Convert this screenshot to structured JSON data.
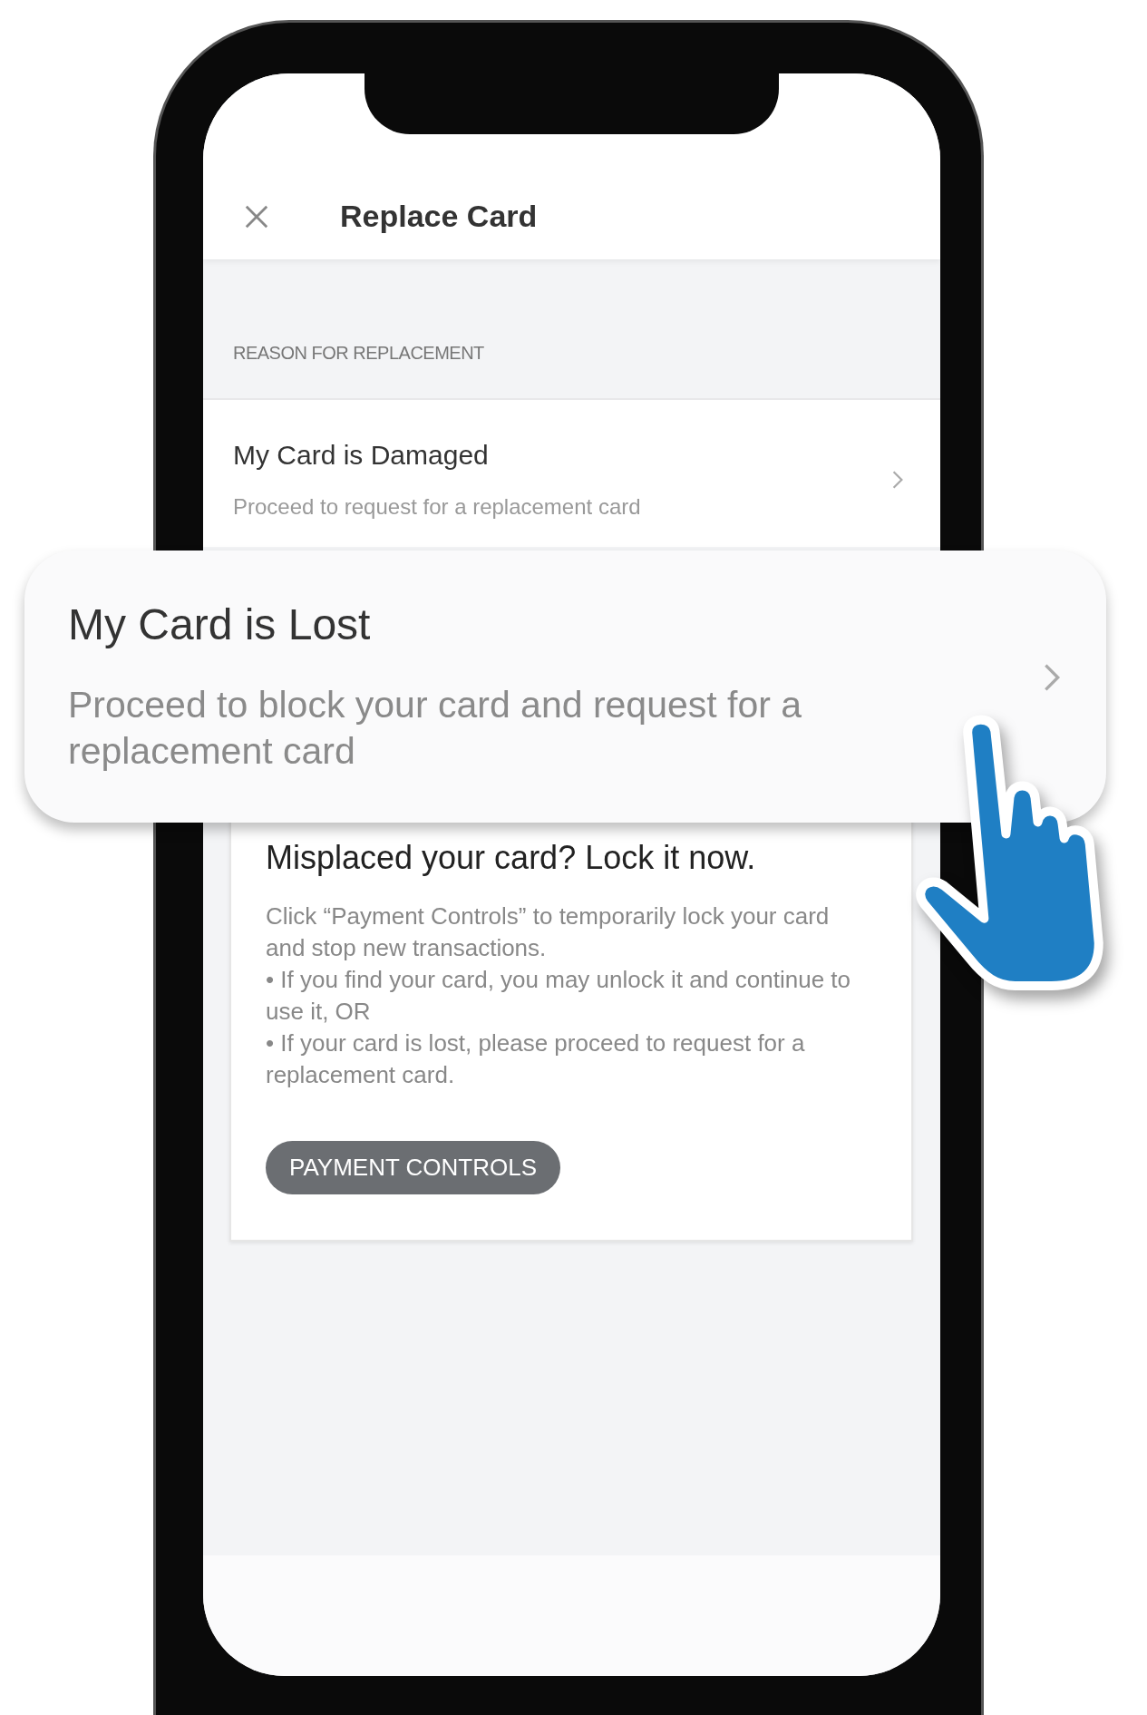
{
  "header": {
    "title": "Replace Card"
  },
  "section_label": "REASON FOR REPLACEMENT",
  "options": [
    {
      "title": "My Card is Damaged",
      "subtitle": "Proceed to request for a replacement card",
      "highlighted": false
    },
    {
      "title": "My Card is Lost",
      "subtitle": "Proceed to block your card and request for a replacement card",
      "highlighted": true
    }
  ],
  "info_card": {
    "title": "Misplaced your card? Lock it now.",
    "body": [
      "Click “Payment Controls” to temporarily lock your card and stop new transactions.",
      "• If you find your card, you may unlock it and continue to use it, OR",
      "• If your card is lost, please proceed to request for a replacement card."
    ],
    "button": "PAYMENT CONTROLS"
  }
}
